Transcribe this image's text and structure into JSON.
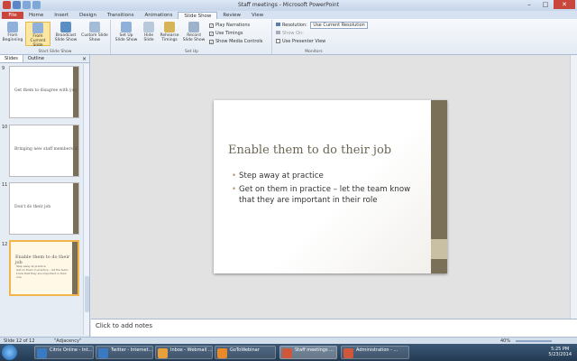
{
  "window": {
    "title": "Staff meetings - Microsoft PowerPoint",
    "min": "–",
    "max": "□",
    "close": "✕"
  },
  "tabs": [
    "File",
    "Home",
    "Insert",
    "Design",
    "Transitions",
    "Animations",
    "Slide Show",
    "Review",
    "View"
  ],
  "ribbon": {
    "from_beginning": "From Beginning",
    "from_current": "From Current Slide",
    "broadcast": "Broadcast Slide Show",
    "custom": "Custom Slide Show",
    "group_start": "Start Slide Show",
    "setup": "Set Up Slide Show",
    "hide": "Hide Slide",
    "rehearse": "Rehearse Timings",
    "record": "Record Slide Show",
    "play_narrations": "Play Narrations",
    "use_timings": "Use Timings",
    "show_media": "Show Media Controls",
    "group_setup": "Set Up",
    "resolution_label": "Resolution:",
    "resolution_value": "Use Current Resolution",
    "show_on_label": "Show On:",
    "presenter_view": "Use Presenter View",
    "group_monitors": "Monitors"
  },
  "panel": {
    "tab_slides": "Slides",
    "tab_outline": "Outline",
    "close": "×",
    "thumbs": [
      {
        "num": "9",
        "title": "Get them to disagree with you"
      },
      {
        "num": "10",
        "title": "Bringing new staff members in"
      },
      {
        "num": "11",
        "title": "Don't do their job"
      },
      {
        "num": "12",
        "title": "Enable them to do their job",
        "b1": "Step away at practice",
        "b2": "Get on them in practice – let the team know that they are important in their role"
      }
    ]
  },
  "slide": {
    "title": "Enable them to do their job",
    "bullet1": "Step away at practice",
    "bullet2": "Get on them in practice – let the team know that they are important in their role"
  },
  "notes_placeholder": "Click to add notes",
  "status": {
    "slide_of": "Slide 12 of 12",
    "theme": "\"Adjacency\"",
    "zoom": "40%"
  },
  "taskbar": {
    "items": [
      "Citrix Online - Int...",
      "Twitter - Internet...",
      "Inbox - Webmail ...",
      "GoToWebinar",
      "Staff meetings ...",
      "Administration - ..."
    ],
    "time": "5:25 PM",
    "date": "5/23/2014"
  },
  "colors": {
    "accent": "#7a7057",
    "file_tab": "#c9463d",
    "selection": "#f0b64b"
  }
}
